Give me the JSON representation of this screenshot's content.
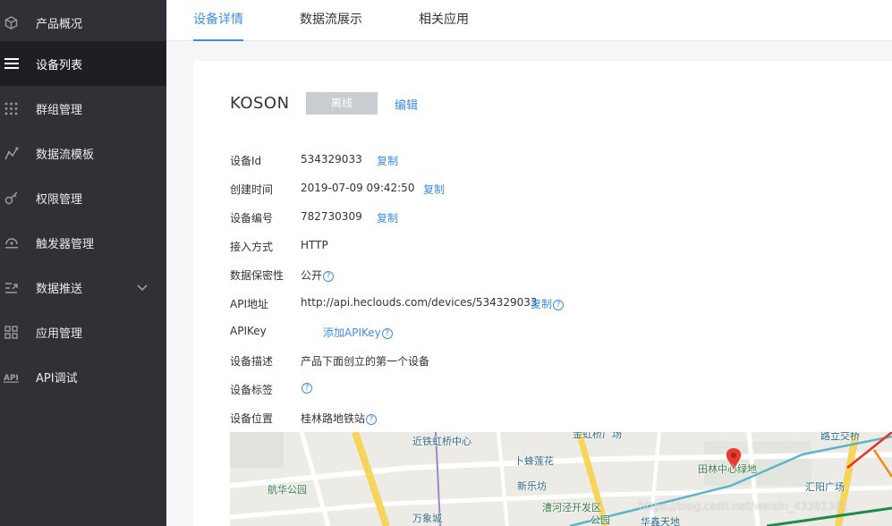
{
  "sidebar": {
    "items": [
      {
        "label": "产品概况",
        "icon": "cube-icon"
      },
      {
        "label": "设备列表",
        "icon": "list-icon"
      },
      {
        "label": "群组管理",
        "icon": "grid-dots-icon"
      },
      {
        "label": "数据流模板",
        "icon": "line-chart-icon"
      },
      {
        "label": "权限管理",
        "icon": "key-icon"
      },
      {
        "label": "触发器管理",
        "icon": "trigger-icon"
      },
      {
        "label": "数据推送",
        "icon": "push-icon"
      },
      {
        "label": "应用管理",
        "icon": "apps-icon"
      },
      {
        "label": "API调试",
        "icon": "api-icon"
      }
    ],
    "active_index": 1
  },
  "tabs": [
    "设备详情",
    "数据流展示",
    "相关应用"
  ],
  "device": {
    "name": "KOSON",
    "status": "离线",
    "edit_label": "编辑"
  },
  "details": {
    "id_label": "设备Id",
    "id_value": "534329033",
    "created_label": "创建时间",
    "created_value": "2019-07-09 09:42:50",
    "code_label": "设备编号",
    "code_value": "782730309",
    "access_label": "接入方式",
    "access_value": "HTTP",
    "privacy_label": "数据保密性",
    "privacy_value": "公开",
    "api_label": "API地址",
    "api_value": "http://api.heclouds.com/devices/534329033",
    "apikey_label": "APIKey",
    "apikey_add": "添加APIKey",
    "desc_label": "设备描述",
    "desc_value": "产品下面创立的第一个设备",
    "tags_label": "设备标签",
    "location_label": "设备位置",
    "location_value": "桂林路地铁站",
    "copy_label": "复制"
  },
  "map": {
    "labels": [
      "近铁虹桥中心",
      "金虹桥广场",
      "路立交桥",
      "卜蜂莲花",
      "田林中心绿地",
      "航华公园",
      "新乐坊",
      "汇阳广场",
      "漕河泾开发区",
      "公园",
      "万象城",
      "华鑫天地"
    ],
    "watermark": "https://blog.csdn.net/weixin_43381381"
  },
  "colors": {
    "accent": "#3f8fe8",
    "sidebar_bg": "#2f3137",
    "sidebar_active": "#1e1f23",
    "status_offline": "#c9ccd1"
  }
}
